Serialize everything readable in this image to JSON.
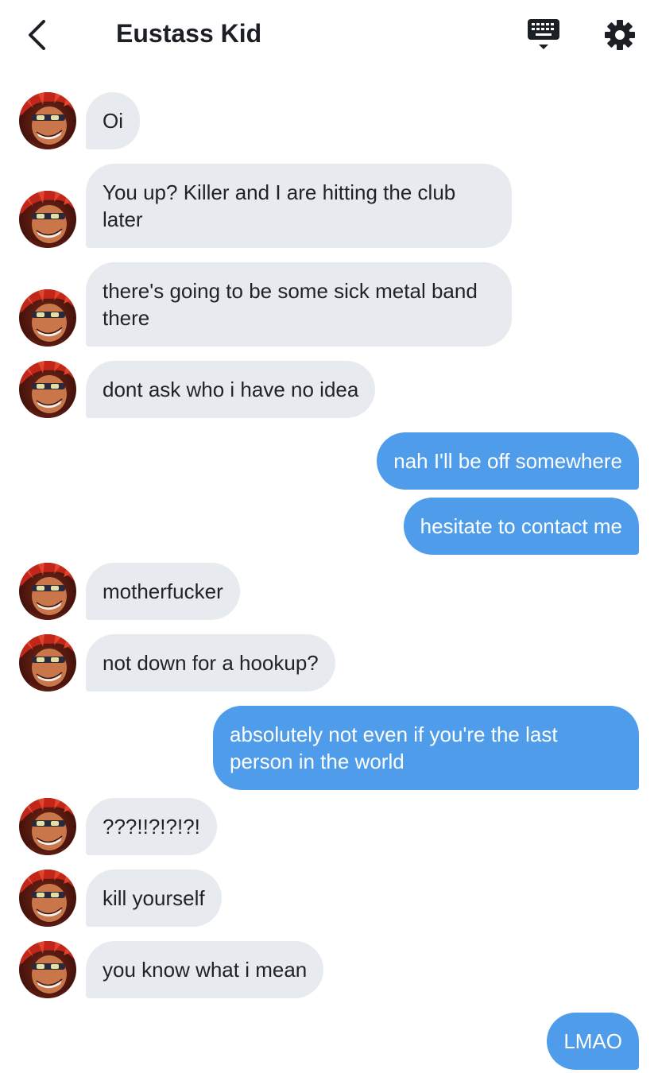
{
  "header": {
    "title": "Eustass Kid",
    "back_icon": "chevron-left-icon",
    "keyboard_icon": "keyboard-icon",
    "settings_icon": "gear-icon"
  },
  "colors": {
    "incoming_bubble": "#e7ebef",
    "outgoing_bubble": "#4f9dea",
    "text": "#1c1f23"
  },
  "messages": [
    {
      "side": "in",
      "text": "Oi"
    },
    {
      "side": "in",
      "text": "You up? Killer and I are hitting the club later"
    },
    {
      "side": "in",
      "text": "there's going to be some sick metal band there"
    },
    {
      "side": "in",
      "text": "dont ask who i have no idea"
    },
    {
      "side": "out",
      "text": "nah I'll be off somewhere"
    },
    {
      "side": "out",
      "text": "hesitate to contact me"
    },
    {
      "side": "in",
      "text": "motherfucker"
    },
    {
      "side": "in",
      "text": "not down for a hookup?"
    },
    {
      "side": "out",
      "text": "absolutely not even if you're the last person in the world"
    },
    {
      "side": "in",
      "text": "???!!?!?!?!"
    },
    {
      "side": "in",
      "text": "kill yourself"
    },
    {
      "side": "in",
      "text": "you know what i mean"
    },
    {
      "side": "out",
      "text": "LMAO"
    }
  ]
}
